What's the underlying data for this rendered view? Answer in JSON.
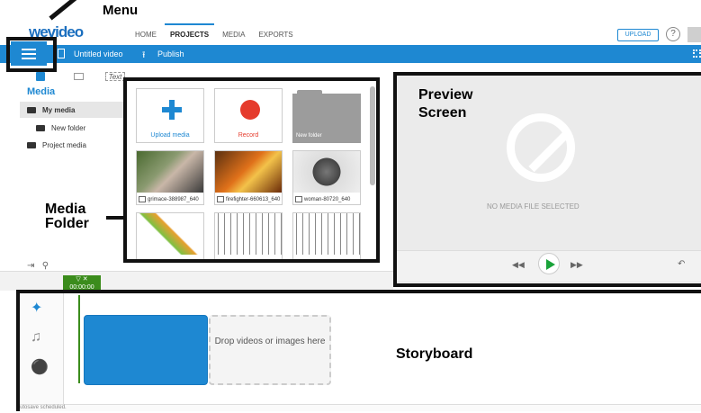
{
  "app": {
    "logo": "wevideo"
  },
  "nav": {
    "items": [
      "HOME",
      "PROJECTS",
      "MEDIA",
      "EXPORTS"
    ],
    "active": "PROJECTS",
    "upload_label": "UPLOAD",
    "help_icon": "?"
  },
  "toolbar": {
    "title": "Untitled video",
    "publish_label": "Publish",
    "upload_icon": "⭱"
  },
  "annotations": {
    "menu": "Menu",
    "media_folder": "Media\nFolder",
    "preview": "Preview\nScreen",
    "storyboard": "Storyboard"
  },
  "left_panel": {
    "tab_text_label": "Text",
    "title": "Media",
    "items": [
      "My media",
      "New folder",
      "Project media"
    ]
  },
  "media_tiles": [
    {
      "label": "Upload media",
      "color": "#1e88d2"
    },
    {
      "label": "Record",
      "color": "#e53b2c"
    },
    {
      "label": "New folder"
    }
  ],
  "thumbnails": [
    {
      "caption": "grimace-388987_640"
    },
    {
      "caption": "firefighter-660613_640"
    },
    {
      "caption": "woman-80720_640"
    }
  ],
  "preview": {
    "no_media": "NO MEDIA FILE SELECTED"
  },
  "timeline": {
    "marker_time": "00:00:00"
  },
  "storyboard": {
    "drop_text": "Drop videos or images here"
  },
  "status": {
    "autosave": "utosave scheduled."
  },
  "colors": {
    "brand_blue": "#1e88d2",
    "record_red": "#e53b2c",
    "play_green": "#1aa33a",
    "marker_green": "#3b8c1c"
  }
}
